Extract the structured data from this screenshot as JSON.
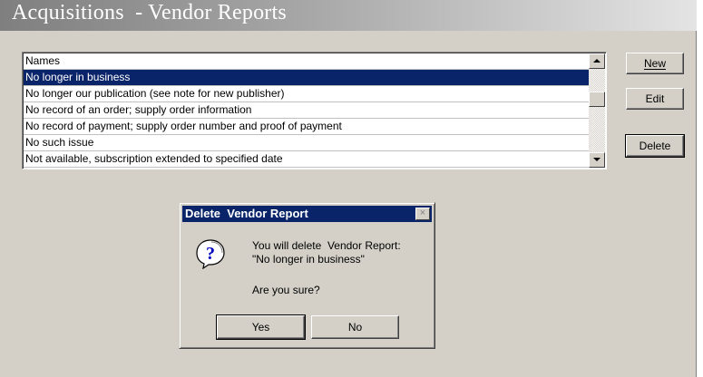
{
  "window": {
    "title": "Acquisitions  - Vendor Reports"
  },
  "list": {
    "header": "Names",
    "items": [
      "No longer in business",
      "No longer our publication (see note for new publisher)",
      "No record of an order; supply order information",
      "No record of payment; supply order number and proof of payment",
      "No such issue",
      "Not available, subscription extended to specified date"
    ],
    "selected_index": 0
  },
  "buttons": {
    "new_label": "New",
    "edit_label": "Edit",
    "delete_label": "Delete"
  },
  "dialog": {
    "title": "Delete  Vendor Report",
    "close_glyph": "×",
    "icon": "question-icon",
    "message_line1": "You will delete  Vendor Report:",
    "message_line2": "\"No longer in business\"",
    "question": "Are you sure?",
    "yes_label": "Yes",
    "no_label": "No"
  },
  "colors": {
    "selection": "#0a246a",
    "dialog_title": "#0a246a",
    "face": "#d4d0c8"
  }
}
